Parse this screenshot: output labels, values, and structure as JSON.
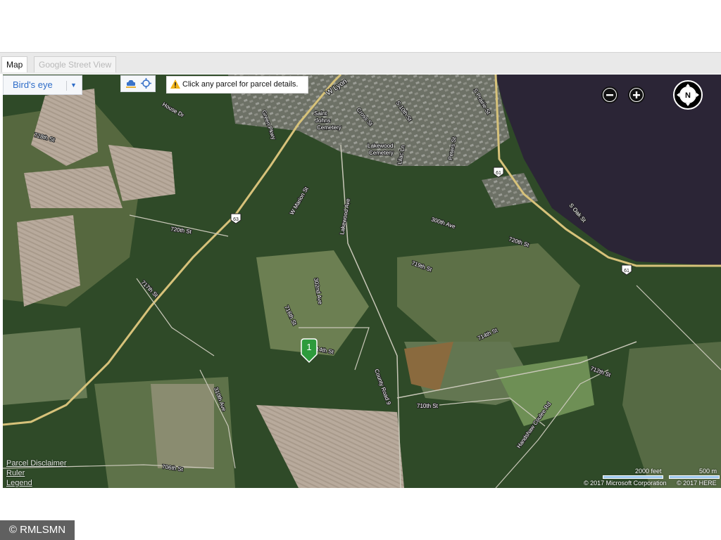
{
  "tabs": [
    {
      "label": "Map",
      "active": true
    },
    {
      "label": "Google Street View",
      "active": false
    }
  ],
  "map": {
    "view_mode": "Bird's eye",
    "notice": "Click any parcel for parcel details.",
    "pin_label": "1",
    "road_labels": [
      "W Lyon",
      "House Dr",
      "Green Pkwy",
      "728th St",
      "Saint",
      "Johns",
      "Cemetery",
      "Cross St",
      "S 10th St",
      "Lakewood",
      "Cemetery",
      "Lilac Ln",
      "Peters St",
      "S Prairie St",
      "W Marion St",
      "Lakewood Ave",
      "720th St",
      "717th St",
      "716th St",
      "302nd Ave",
      "714th St",
      "310th Ave",
      "706th St",
      "300th Ave",
      "720th St",
      "719th St",
      "S Oak St",
      "714th St",
      "712th St",
      "County Road 9",
      "710th St",
      "Handshaw Coulee Rd"
    ],
    "highway_shields": [
      "61",
      "61",
      "63"
    ],
    "scale": {
      "feet_label": "2000 feet",
      "meters_label": "500 m"
    },
    "copyrights": [
      "© 2017 Microsoft Corporation",
      "© 2017 HERE"
    ],
    "side_links": [
      "Parcel Disclaimer",
      "Ruler",
      "Legend"
    ],
    "colors": {
      "water": "#2a2535",
      "forest": "#2e4a27",
      "field": "#6c7f52",
      "road": "#c9b56a"
    }
  },
  "watermark": "© RMLSMN"
}
